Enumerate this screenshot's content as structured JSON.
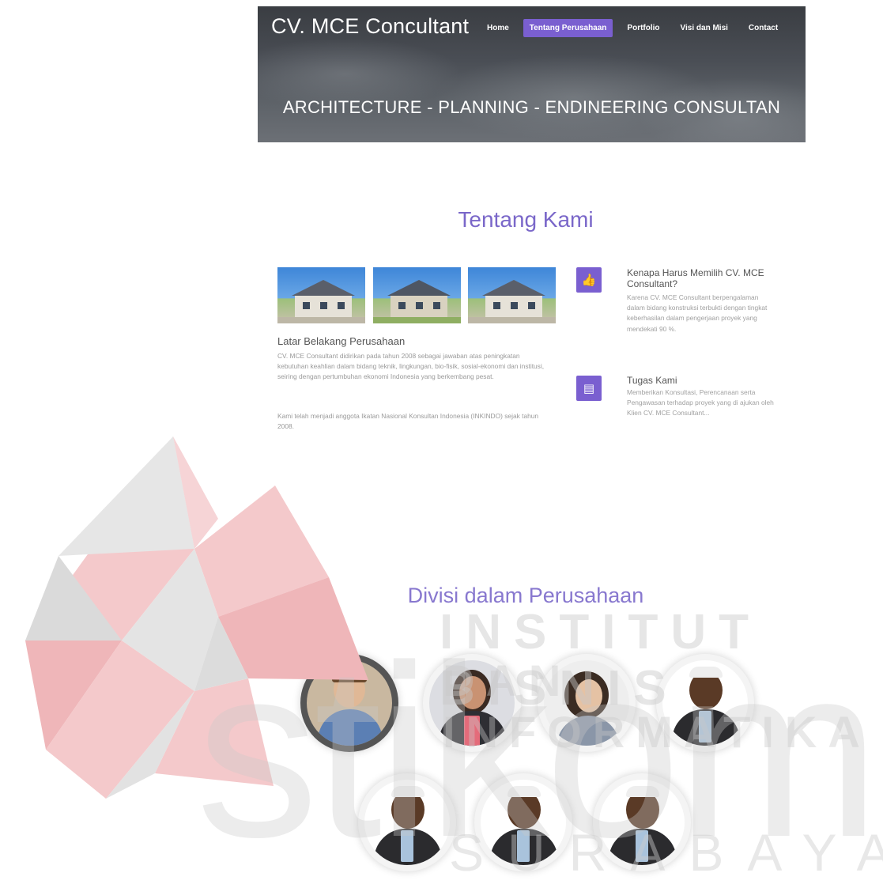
{
  "site": {
    "brand": "CV. MCE Concultant",
    "tagline": "ARCHITECTURE - PLANNING - ENDINEERING CONSULTAN"
  },
  "nav": {
    "items": [
      {
        "label": "Home",
        "active": false
      },
      {
        "label": "Tentang Perusahaan",
        "active": true
      },
      {
        "label": "Portfolio",
        "active": false
      },
      {
        "label": "Visi dan Misi",
        "active": false
      },
      {
        "label": "Contact",
        "active": false
      }
    ]
  },
  "about": {
    "title": "Tentang Kami",
    "background_heading": "Latar Belakang Perusahaan",
    "paragraph1": "CV. MCE Consultant didirikan pada tahun 2008 sebagai jawaban atas peningkatan kebutuhan keahlian dalam bidang teknik, lingkungan, bio-fisik, sosial-ekonomi dan institusi, seiring dengan pertumbuhan ekonomi Indonesia yang berkembang pesat.",
    "paragraph2": "Kami telah menjadi anggota Ikatan Nasional Konsultan Indonesia (INKINDO) sejak tahun 2008.",
    "features": [
      {
        "icon": "thumbs-up-icon",
        "title": "Kenapa Harus Memilih CV. MCE Consultant?",
        "text": "Karena CV. MCE Consultant berpengalaman dalam bidang konstruksi terbukti dengan tingkat keberhasilan dalam pengerjaan proyek yang mendekati 90 %."
      },
      {
        "icon": "list-icon",
        "title": "Tugas Kami",
        "text": "Memberikan Konsultasi, Perencanaan serta Pengawasan terhadap proyek yang di ajukan oleh Klien CV. MCE Consultant..."
      }
    ]
  },
  "divisions": {
    "title": "Divisi dalam Perusahaan"
  },
  "watermark": {
    "line1": "INSTITUT BISNIS",
    "line2": "DAN INFORMATIKA",
    "logo_text": "stikom",
    "line3": "SURABAYA"
  },
  "colors": {
    "accent": "#7a5fd0",
    "heading": "#7a67c9",
    "hero_bg": "#4a4e55",
    "watermark_red": "#f4c7c9",
    "watermark_gray": "#d8d8d8"
  }
}
